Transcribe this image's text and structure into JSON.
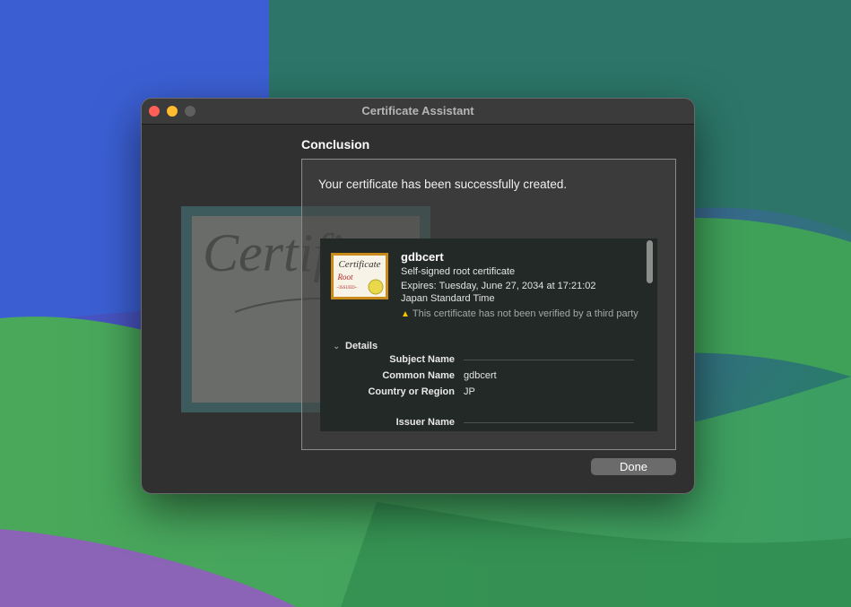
{
  "window": {
    "title": "Certificate Assistant"
  },
  "section": {
    "heading": "Conclusion"
  },
  "message": "Your certificate has been successfully created.",
  "certificate": {
    "name": "gdbcert",
    "type": "Self-signed root certificate",
    "expires": "Expires: Tuesday, June 27, 2034 at 17:21:02",
    "timezone": "Japan Standard Time",
    "warning": "This certificate has not been verified by a third party",
    "thumb_line1": "Certificate",
    "thumb_line2": "Root",
    "thumb_line3": "~ISSUED~"
  },
  "art": {
    "text": "Certifi"
  },
  "details": {
    "label": "Details",
    "subject_header": "Subject Name",
    "fields": [
      {
        "label": "Common Name",
        "value": "gdbcert"
      },
      {
        "label": "Country or Region",
        "value": "JP"
      }
    ],
    "issuer_header": "Issuer Name"
  },
  "buttons": {
    "done": "Done"
  },
  "colors": {
    "close": "#fe5f57",
    "minimize": "#febc2e",
    "zoom_disabled": "#5e5f5e",
    "warning": "#f5c400",
    "seal": "#e8d84a"
  },
  "icons": {
    "warning": "warning-triangle-icon",
    "disclosure": "chevron-down-icon",
    "certificate": "certificate-icon"
  }
}
